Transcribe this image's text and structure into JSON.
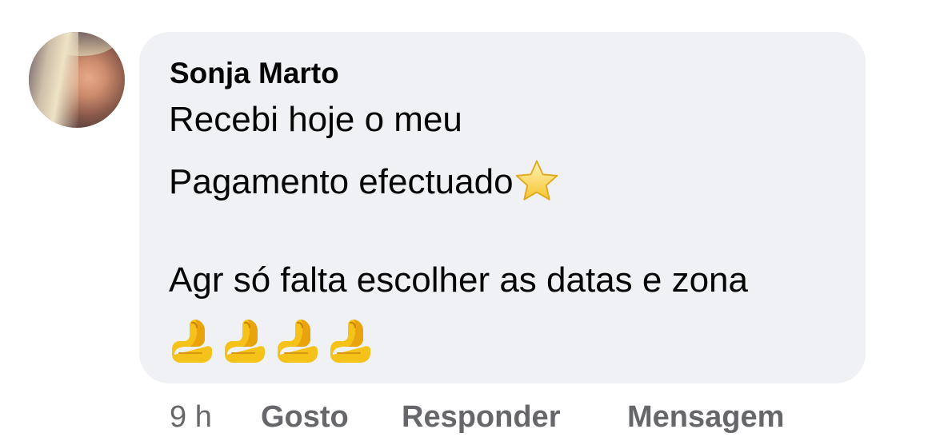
{
  "comment": {
    "author": "Sonja Marto",
    "lines": [
      "Recebi hoje o meu",
      "Pagamento efectuado",
      "Agr só falta escolher as datas e zona"
    ],
    "emoji": {
      "star": "star-emoji",
      "pinch_count": 4,
      "pinch": "pinched-fingers-emoji"
    },
    "colors": {
      "bubble": "#f0f1f4",
      "text": "#050505",
      "meta": "#65676b"
    }
  },
  "meta": {
    "time": "9 h",
    "like_label": "Gosto",
    "reply_label": "Responder",
    "message_label": "Mensagem"
  }
}
